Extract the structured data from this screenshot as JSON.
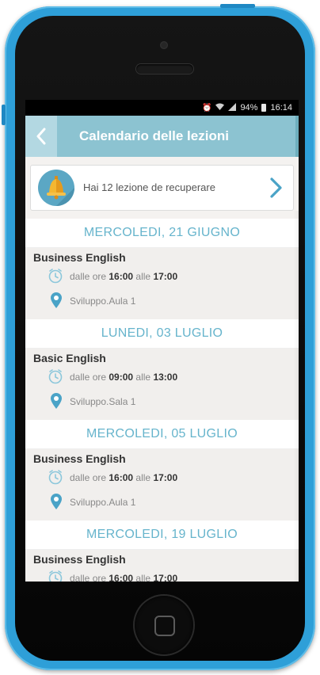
{
  "status_bar": {
    "icons": [
      "alarm-icon",
      "wifi-icon",
      "signal-icon"
    ],
    "battery": "94%",
    "time": "16:14"
  },
  "header": {
    "title": "Calendario delle lezioni",
    "back_icon": "chevron-left-icon"
  },
  "banner": {
    "text": "Hai 12 lezione de recuperare",
    "icon": "bell-icon",
    "chevron": "chevron-right-icon"
  },
  "labels": {
    "time_prefix": "dalle ore",
    "time_middle": "alle"
  },
  "lessons": [
    {
      "date": "MERCOLEDI, 21 GIUGNO",
      "title": "Business English",
      "start": "16:00",
      "end": "17:00",
      "location": "Sviluppo.Aula 1"
    },
    {
      "date": "LUNEDI, 03 LUGLIO",
      "title": "Basic English",
      "start": "09:00",
      "end": "13:00",
      "location": "Sviluppo.Sala 1"
    },
    {
      "date": "MERCOLEDI, 05 LUGLIO",
      "title": "Business English",
      "start": "16:00",
      "end": "17:00",
      "location": "Sviluppo.Aula 1"
    },
    {
      "date": "MERCOLEDI, 19 LUGLIO",
      "title": "Business English",
      "start": "16:00",
      "end": "17:00",
      "location": ""
    }
  ],
  "colors": {
    "header": "#8cc3d1",
    "accent": "#66b4cc",
    "phone": "#2e9fd8"
  }
}
